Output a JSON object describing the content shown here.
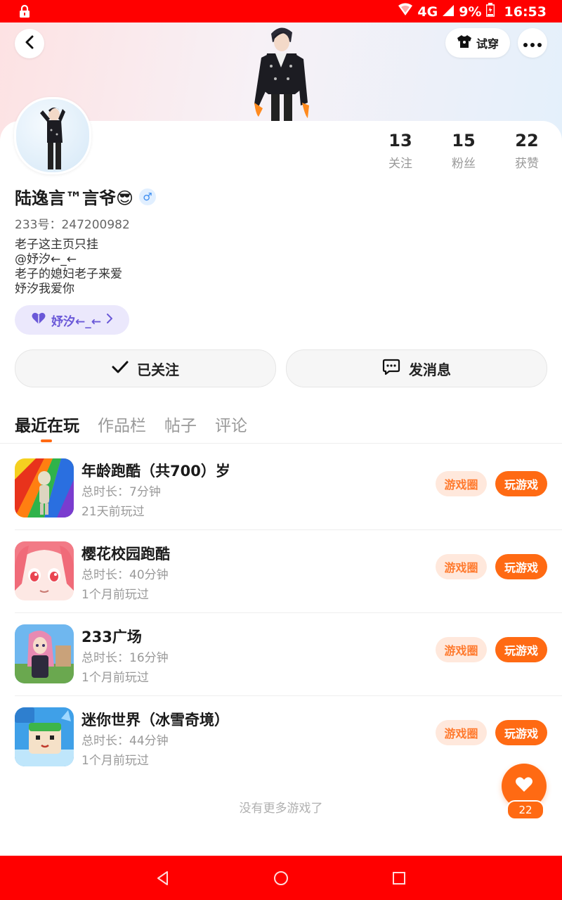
{
  "status_bar": {
    "network": "4G",
    "battery": "9%",
    "time": "16:53"
  },
  "header": {
    "tryon_label": "试穿"
  },
  "profile": {
    "name": "陆逸言™言爷😎",
    "gender_symbol": "♂",
    "uid": "233号：247200982",
    "bio": [
      "老子这主页只挂",
      "@妤汐←_←",
      "老子的媳妇老子来爱",
      "妤汐我爱你"
    ],
    "tag_label": "妤汐←_←"
  },
  "stats": [
    {
      "value": "13",
      "label": "关注"
    },
    {
      "value": "15",
      "label": "粉丝"
    },
    {
      "value": "22",
      "label": "获赞"
    }
  ],
  "actions": {
    "follow_label": "已关注",
    "message_label": "发消息"
  },
  "tabs": [
    {
      "label": "最近在玩",
      "active": true
    },
    {
      "label": "作品栏",
      "active": false
    },
    {
      "label": "帖子",
      "active": false
    },
    {
      "label": "评论",
      "active": false
    }
  ],
  "games": [
    {
      "name": "年龄跑酷（共700）岁",
      "duration": "总时长：7分钟",
      "last_played": "21天前玩过"
    },
    {
      "name": "樱花校园跑酷",
      "duration": "总时长：40分钟",
      "last_played": "1个月前玩过"
    },
    {
      "name": "233广场",
      "duration": "总时长：16分钟",
      "last_played": "1个月前玩过"
    },
    {
      "name": "迷你世界（冰雪奇境）",
      "duration": "总时长：44分钟",
      "last_played": "1个月前玩过"
    }
  ],
  "game_buttons": {
    "circle_label": "游戏圈",
    "play_label": "玩游戏"
  },
  "list_footer": "没有更多游戏了",
  "like_fab": {
    "count": "22"
  },
  "colors": {
    "accent": "#ff6a13",
    "system_bars": "#ff0000"
  }
}
